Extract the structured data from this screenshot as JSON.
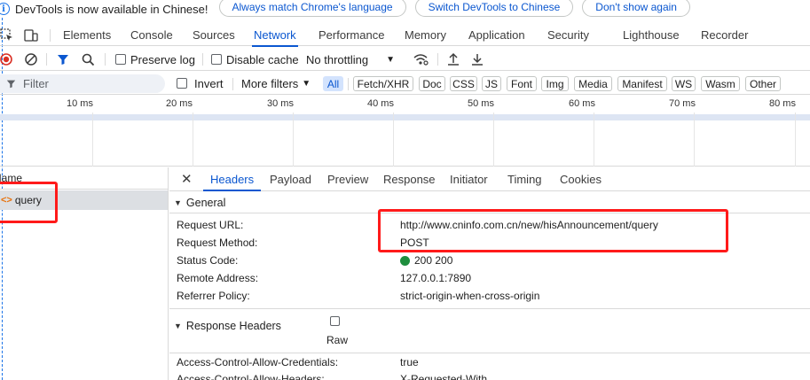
{
  "infobar": {
    "text": "DevTools is now available in Chinese!",
    "btn_match": "Always match Chrome's language",
    "btn_switch": "Switch DevTools to Chinese",
    "btn_dont": "Don't show again"
  },
  "tabs": [
    "Elements",
    "Console",
    "Sources",
    "Network",
    "Performance",
    "Memory",
    "Application",
    "Security",
    "Lighthouse",
    "Recorder"
  ],
  "toolbar": {
    "preserve_log": "Preserve log",
    "disable_cache": "Disable cache",
    "throttling": "No throttling"
  },
  "filter": {
    "placeholder": "Filter",
    "invert": "Invert",
    "more_filters": "More filters",
    "chips": [
      "All",
      "Fetch/XHR",
      "Doc",
      "CSS",
      "JS",
      "Font",
      "Img",
      "Media",
      "Manifest",
      "WS",
      "Wasm",
      "Other"
    ]
  },
  "timeline": {
    "ticks": [
      "10 ms",
      "20 ms",
      "30 ms",
      "40 ms",
      "50 ms",
      "60 ms",
      "70 ms",
      "80 ms"
    ]
  },
  "request_list": {
    "header": "Name",
    "rows": [
      {
        "name": "query"
      }
    ]
  },
  "detail_tabs": [
    "Headers",
    "Payload",
    "Preview",
    "Response",
    "Initiator",
    "Timing",
    "Cookies"
  ],
  "general": {
    "title": "General",
    "rows": [
      {
        "key": "Request URL:",
        "value": "http://www.cninfo.com.cn/new/hisAnnouncement/query"
      },
      {
        "key": "Request Method:",
        "value": "POST"
      },
      {
        "key": "Status Code:",
        "value": "200 200"
      },
      {
        "key": "Remote Address:",
        "value": "127.0.0.1:7890"
      },
      {
        "key": "Referrer Policy:",
        "value": "strict-origin-when-cross-origin"
      }
    ]
  },
  "response_headers": {
    "title": "Response Headers",
    "raw_label": "Raw",
    "rows": [
      {
        "key": "Access-Control-Allow-Credentials:",
        "value": "true"
      },
      {
        "key": "Access-Control-Allow-Headers:",
        "value": "X-Requested-With"
      }
    ]
  },
  "colors": {
    "accent": "#0b57d0",
    "status_ok": "#1e8e3e",
    "record": "#d93025",
    "annotation": "#ff1a1a"
  }
}
